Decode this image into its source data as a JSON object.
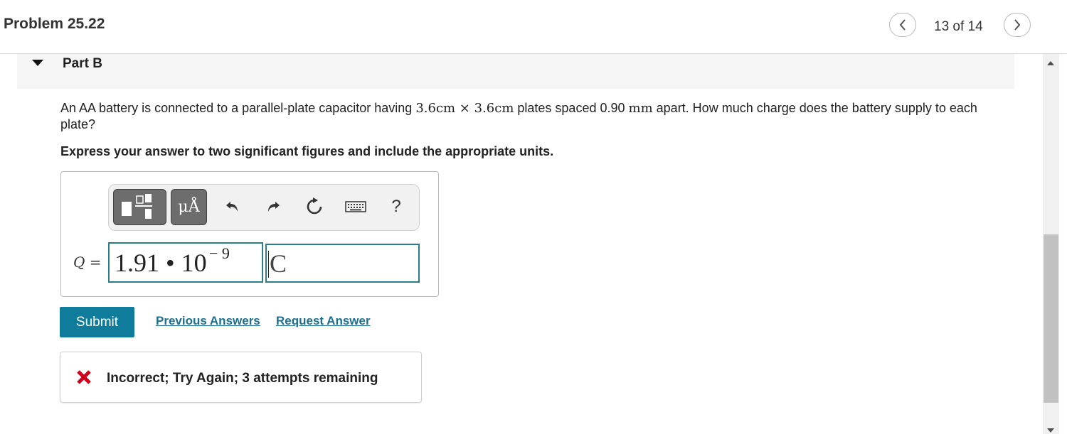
{
  "header": {
    "title": "Problem 25.22",
    "counter": "13 of 14"
  },
  "part": {
    "title": "Part B"
  },
  "question": {
    "text_before": "An AA battery is connected to a parallel-plate capacitor having ",
    "plate_dims": "3.6cm × 3.6cm",
    "text_middle": " plates spaced 0.90 ",
    "spacing_unit": "mm",
    "text_after": " apart. How much charge does the battery supply to each plate?"
  },
  "instruction": "Express your answer to two significant figures and include the appropriate units.",
  "toolbar": {
    "units_label": "μÅ",
    "help_label": "?"
  },
  "answer": {
    "variable": "Q",
    "equals": "=",
    "value_mantissa": "1.91 • 10",
    "value_exponent": "− 9",
    "units": "C"
  },
  "actions": {
    "submit_label": "Submit",
    "previous_answers_label": "Previous Answers",
    "request_answer_label": "Request Answer"
  },
  "feedback": {
    "text": "Incorrect; Try Again; 3 attempts remaining"
  },
  "colors": {
    "accent": "#0e7c9a",
    "link": "#1b6f8f",
    "error": "#d0021b",
    "field_border": "#2c7d8c"
  }
}
